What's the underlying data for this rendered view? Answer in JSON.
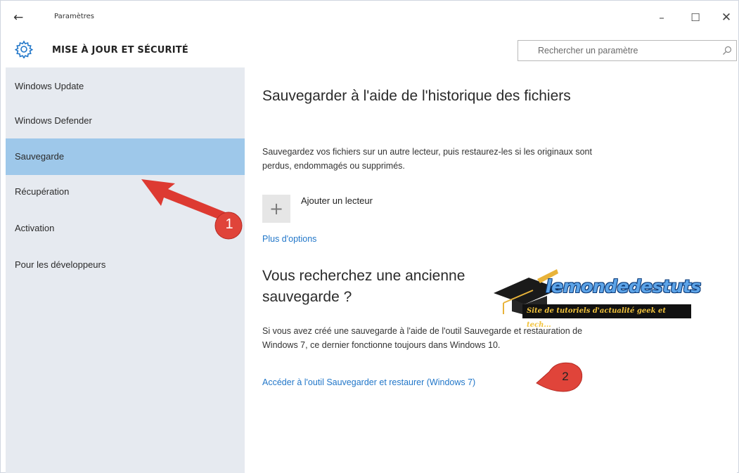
{
  "titlebar": {
    "title": "Paramètres",
    "back_icon": "back-arrow-icon",
    "minimize_label": "–",
    "maximize_label": "☐",
    "close_label": "✕"
  },
  "header": {
    "icon": "gear-icon",
    "title": "MISE À JOUR ET SÉCURITÉ",
    "search_placeholder": "Rechercher un paramètre"
  },
  "sidebar": {
    "items": [
      {
        "label": "Windows Update",
        "active": false
      },
      {
        "label": "Windows Defender",
        "active": false
      },
      {
        "label": "Sauvegarde",
        "active": true
      },
      {
        "label": "Récupération",
        "active": false
      },
      {
        "label": "Activation",
        "active": false
      },
      {
        "label": "Pour les développeurs",
        "active": false
      }
    ]
  },
  "main": {
    "section1": {
      "title": "Sauvegarder à l'aide de l'historique des fichiers",
      "description": "Sauvegardez vos fichiers sur un autre lecteur, puis restaurez-les si les originaux sont perdus, endommagés ou supprimés.",
      "add_drive_label": "Ajouter un lecteur",
      "more_options_link": "Plus d'options"
    },
    "section2": {
      "title": "Vous recherchez une ancienne sauvegarde ?",
      "description": "Si vous avez créé une sauvegarde à l'aide de l'outil Sauvegarde et restauration de Windows 7, ce dernier fonctionne toujours dans Windows 10.",
      "restore_link": "Accéder à l'outil Sauvegarder et restaurer (Windows 7)"
    }
  },
  "watermark": {
    "logo_text": "lemondedestuts",
    "tagline": "Site de tutoriels d'actualité geek et tech..."
  },
  "annotations": {
    "marker1": "1",
    "marker2": "2"
  },
  "colors": {
    "accent": "#2277c9",
    "selection": "#9ec8ea",
    "sidebar_bg": "#e6eaf0",
    "annotation_red": "#e0443a"
  }
}
